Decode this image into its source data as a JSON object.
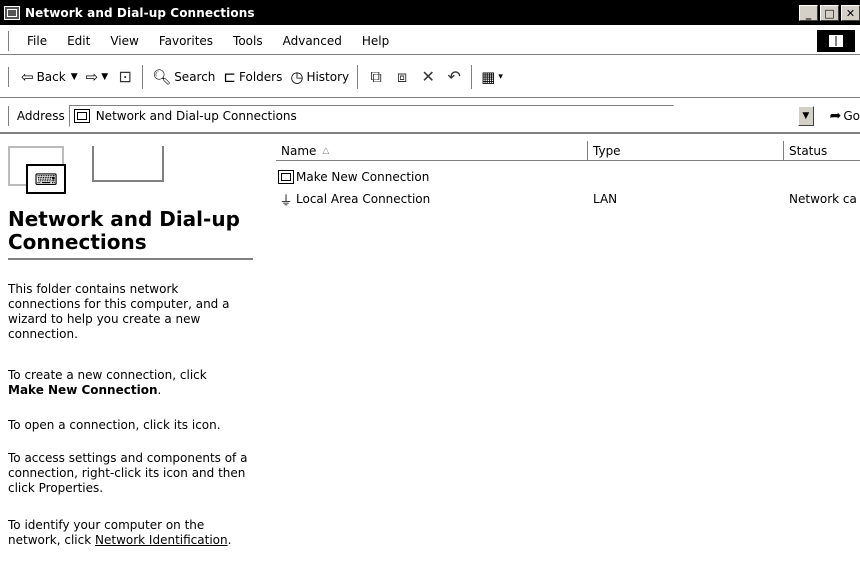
{
  "window": {
    "title": "Network and Dial-up Connections"
  },
  "menubar": {
    "items": [
      "File",
      "Edit",
      "View",
      "Favorites",
      "Tools",
      "Advanced",
      "Help"
    ]
  },
  "toolbar": {
    "back_label": "Back",
    "search_label": "Search",
    "folders_label": "Folders",
    "history_label": "History"
  },
  "address": {
    "label": "Address",
    "value": "Network and Dial-up Connections",
    "go_label": "Go"
  },
  "leftpane": {
    "title": "Network and Dial-up Connections",
    "p1": "This folder contains network connections for this computer, and a wizard to help you create a new connection.",
    "p2_prefix": "To create a new connection, click",
    "p2_bold": "Make New Connection",
    "p2_suffix": ".",
    "p3": "To open a connection, click its icon.",
    "p4": "To access settings and components of a connection, right-click its icon and then click Properties.",
    "p5_prefix": "To identify your computer on the network, click",
    "p5_link": "Network Identification",
    "p5_suffix": "."
  },
  "listview": {
    "columns": [
      "Name",
      "Type",
      "Status"
    ],
    "rows": [
      {
        "name": "Make New Connection",
        "type": "",
        "status": ""
      },
      {
        "name": "Local Area Connection",
        "type": "LAN",
        "status": "Network ca"
      }
    ]
  }
}
